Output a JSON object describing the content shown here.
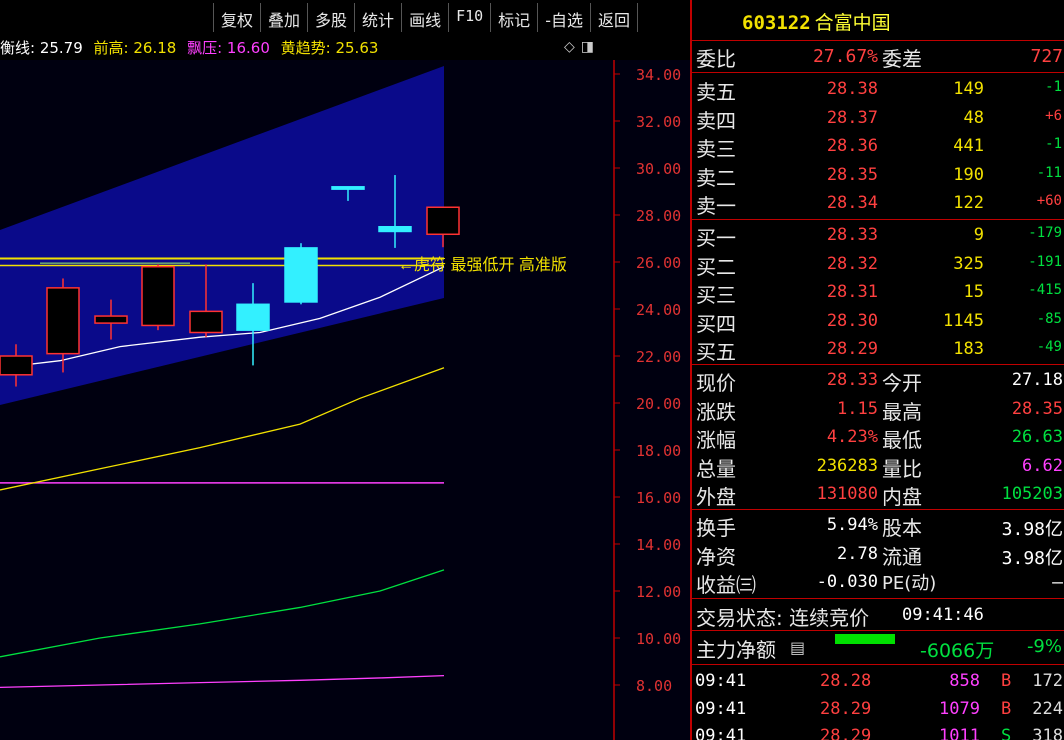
{
  "toolbar": {
    "items": [
      "复权",
      "叠加",
      "多股",
      "统计",
      "画线",
      "F10",
      "标记",
      "-自选",
      "返回"
    ]
  },
  "indicators": {
    "heng": "衡线: 25.79",
    "qiangao": "前高: 26.18",
    "piaoya": "飘压: 16.60",
    "huangqushi": "黄趋势: 25.63",
    "colors": {
      "heng": "#ffffff",
      "qiangao": "#f2e100",
      "piaoya": "#ff40ff",
      "huangqushi": "#f2e100"
    }
  },
  "chart_data": {
    "type": "candlestick",
    "y_ticks": [
      "34.00",
      "32.00",
      "30.00",
      "28.00",
      "26.00",
      "24.00",
      "22.00",
      "20.00",
      "18.00",
      "16.00",
      "14.00",
      "12.00",
      "10.00",
      "8.00"
    ],
    "ylim": [
      7.2,
      35.2
    ],
    "annotation": "←虎符 最强低开 高准版",
    "candles": [
      {
        "open": 21.2,
        "high": 22.5,
        "low": 20.7,
        "close": 22.0
      },
      {
        "open": 22.1,
        "high": 25.3,
        "low": 21.3,
        "close": 24.9
      },
      {
        "open": 23.4,
        "high": 24.4,
        "low": 22.7,
        "close": 23.7
      },
      {
        "open": 23.3,
        "high": 25.9,
        "low": 23.1,
        "close": 25.8
      },
      {
        "open": 23.0,
        "high": 25.9,
        "low": 22.8,
        "close": 23.9
      },
      {
        "open": 24.2,
        "high": 25.1,
        "low": 21.6,
        "close": 23.1
      },
      {
        "open": 26.6,
        "high": 26.8,
        "low": 24.2,
        "close": 24.3
      },
      {
        "open": 29.2,
        "high": 29.2,
        "low": 28.6,
        "close": 29.1
      },
      {
        "open": 27.5,
        "high": 29.7,
        "low": 26.6,
        "close": 27.3
      },
      {
        "open": 27.18,
        "high": 28.35,
        "low": 26.63,
        "close": 28.33
      }
    ]
  },
  "panel": {
    "code": "603122",
    "name": "合富中国",
    "weibi_label": "委比",
    "weibi_value": "27.67%",
    "weicha_label": "委差",
    "weicha_value": "727",
    "asks": [
      {
        "label": "卖五",
        "price": "28.38",
        "vol": "149",
        "chg": "-1"
      },
      {
        "label": "卖四",
        "price": "28.37",
        "vol": "48",
        "chg": "+6"
      },
      {
        "label": "卖三",
        "price": "28.36",
        "vol": "441",
        "chg": "-1"
      },
      {
        "label": "卖二",
        "price": "28.35",
        "vol": "190",
        "chg": "-11"
      },
      {
        "label": "卖一",
        "price": "28.34",
        "vol": "122",
        "chg": "+60"
      }
    ],
    "bids": [
      {
        "label": "买一",
        "price": "28.33",
        "vol": "9",
        "chg": "-179"
      },
      {
        "label": "买二",
        "price": "28.32",
        "vol": "325",
        "chg": "-191"
      },
      {
        "label": "买三",
        "price": "28.31",
        "vol": "15",
        "chg": "-415"
      },
      {
        "label": "买四",
        "price": "28.30",
        "vol": "1145",
        "chg": "-85"
      },
      {
        "label": "买五",
        "price": "28.29",
        "vol": "183",
        "chg": "-49"
      }
    ],
    "quote": [
      {
        "l1": "现价",
        "v1": "28.33",
        "c1": "red",
        "l2": "今开",
        "v2": "27.18",
        "c2": "wht"
      },
      {
        "l1": "涨跌",
        "v1": "1.15",
        "c1": "red",
        "l2": "最高",
        "v2": "28.35",
        "c2": "red"
      },
      {
        "l1": "涨幅",
        "v1": "4.23%",
        "c1": "red",
        "l2": "最低",
        "v2": "26.63",
        "c2": "grn"
      },
      {
        "l1": "总量",
        "v1": "236283",
        "c1": "yel",
        "l2": "量比",
        "v2": "6.62",
        "c2": "mag"
      },
      {
        "l1": "外盘",
        "v1": "131080",
        "c1": "red",
        "l2": "内盘",
        "v2": "105203",
        "c2": "grn"
      }
    ],
    "stats": [
      {
        "l1": "换手",
        "v1": "5.94%",
        "l2": "股本",
        "v2": "3.98亿"
      },
      {
        "l1": "净资",
        "v1": "2.78",
        "l2": "流通",
        "v2": "3.98亿"
      },
      {
        "l1": "收益㈢",
        "v1": "-0.030",
        "l2": "PE(动)",
        "v2": "—"
      }
    ],
    "trade_status": "交易状态: 连续竞价",
    "trade_time": "09:41:46",
    "zhuli_label": "主力净额",
    "zhuli_value": "-6066万",
    "zhuli_pct": "-9%",
    "ticks": [
      {
        "time": "09:41",
        "price": "28.28",
        "vol": "858",
        "side": "B",
        "num": "172"
      },
      {
        "time": "09:41",
        "price": "28.29",
        "vol": "1079",
        "side": "B",
        "num": "224"
      },
      {
        "time": "09:41",
        "price": "28.29",
        "vol": "1011",
        "side": "S",
        "num": "318"
      }
    ]
  }
}
